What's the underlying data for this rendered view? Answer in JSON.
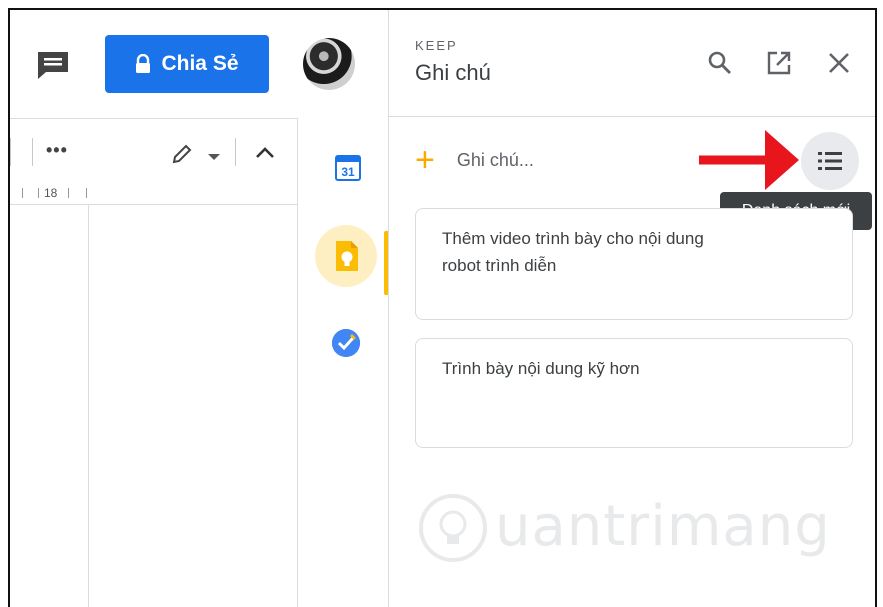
{
  "share": {
    "label": "Chia Sẻ"
  },
  "toolbar": {
    "more": "•••"
  },
  "ruler": {
    "number": "18"
  },
  "keep": {
    "label": "KEEP",
    "title": "Ghi chú",
    "add_placeholder": "Ghi chú...",
    "new_list_tooltip": "Danh sách mới",
    "notes": [
      {
        "text_line1": "Thêm video trình bày cho nội dung",
        "text_line2": "robot trình diễn"
      },
      {
        "text_line1": "Trình bày nội dung kỹ hơn"
      }
    ]
  },
  "watermark": {
    "text": "uantrimang"
  },
  "sidebar": {
    "calendar_day": "31"
  },
  "colors": {
    "share_button": "#1a73e8",
    "keep_accent": "#fbbc04",
    "keep_bg": "#feefc3",
    "arrow": "#e8161c",
    "tooltip_bg": "#3c4043"
  },
  "icons": [
    "comment-icon",
    "lock-icon",
    "pencil-icon",
    "chevron-up-icon",
    "calendar-icon",
    "keep-icon",
    "tasks-icon",
    "search-icon",
    "open-in-new-icon",
    "close-icon",
    "plus-icon",
    "list-icon",
    "red-arrow"
  ]
}
